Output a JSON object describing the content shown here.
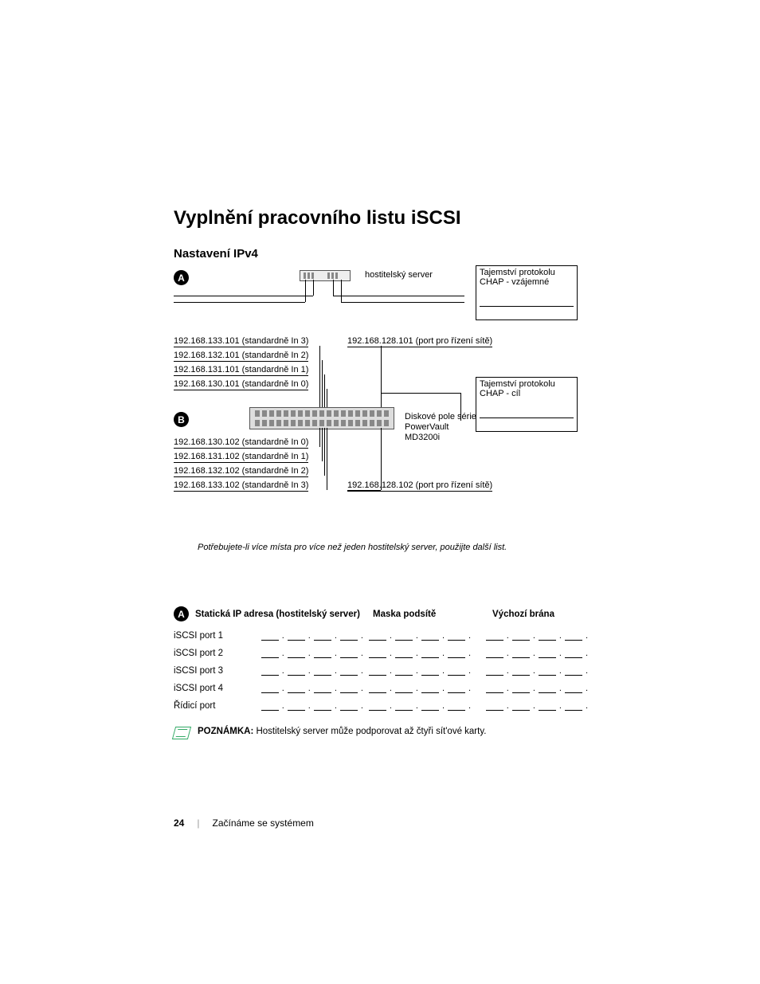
{
  "title": "Vyplnění pracovního listu iSCSI",
  "subtitle": "Nastavení IPv4",
  "letters": {
    "a": "A",
    "b": "B"
  },
  "diagram": {
    "host_label": "hostitelský server",
    "chap_mutual_title": "Tajemství protokolu CHAP - vzájemné",
    "chap_target_title": "Tajemství protokolu CHAP - cíl",
    "a_ips": [
      "192.168.133.101 (standardně In 3)",
      "192.168.132.101 (standardně In 2)",
      "192.168.131.101 (standardně In 1)",
      "192.168.130.101 (standardně In 0)"
    ],
    "mgmt_a": "192.168.128.101 (port pro řízení sítě)",
    "b_ips": [
      "192.168.130.102 (standardně In 0)",
      "192.168.131.102 (standardně In 1)",
      "192.168.132.102 (standardně In 2)",
      "192.168.133.102 (standardně In 3)"
    ],
    "mgmt_b": "192.168.128.102 (port pro řízení sítě)",
    "array_label_1": "Diskové pole série",
    "array_label_2": "PowerVault",
    "array_label_3": "MD3200i"
  },
  "note_italic": "Potřebujete-li více místa pro více než jeden hostitelský server, použijte další list.",
  "table": {
    "header_a": "Statická IP adresa (hostitelský server)",
    "header_b": "Maska podsítě",
    "header_c": "Výchozí brána",
    "rows": [
      "iSCSI port 1",
      "iSCSI port 2",
      "iSCSI port 3",
      "iSCSI port 4",
      "Řídicí port"
    ]
  },
  "note": {
    "label": "POZNÁMKA:",
    "text": " Hostitelský server může podporovat až čtyři sít'ové karty."
  },
  "footer": {
    "page": "24",
    "chapter": "Začínáme se systémem"
  }
}
